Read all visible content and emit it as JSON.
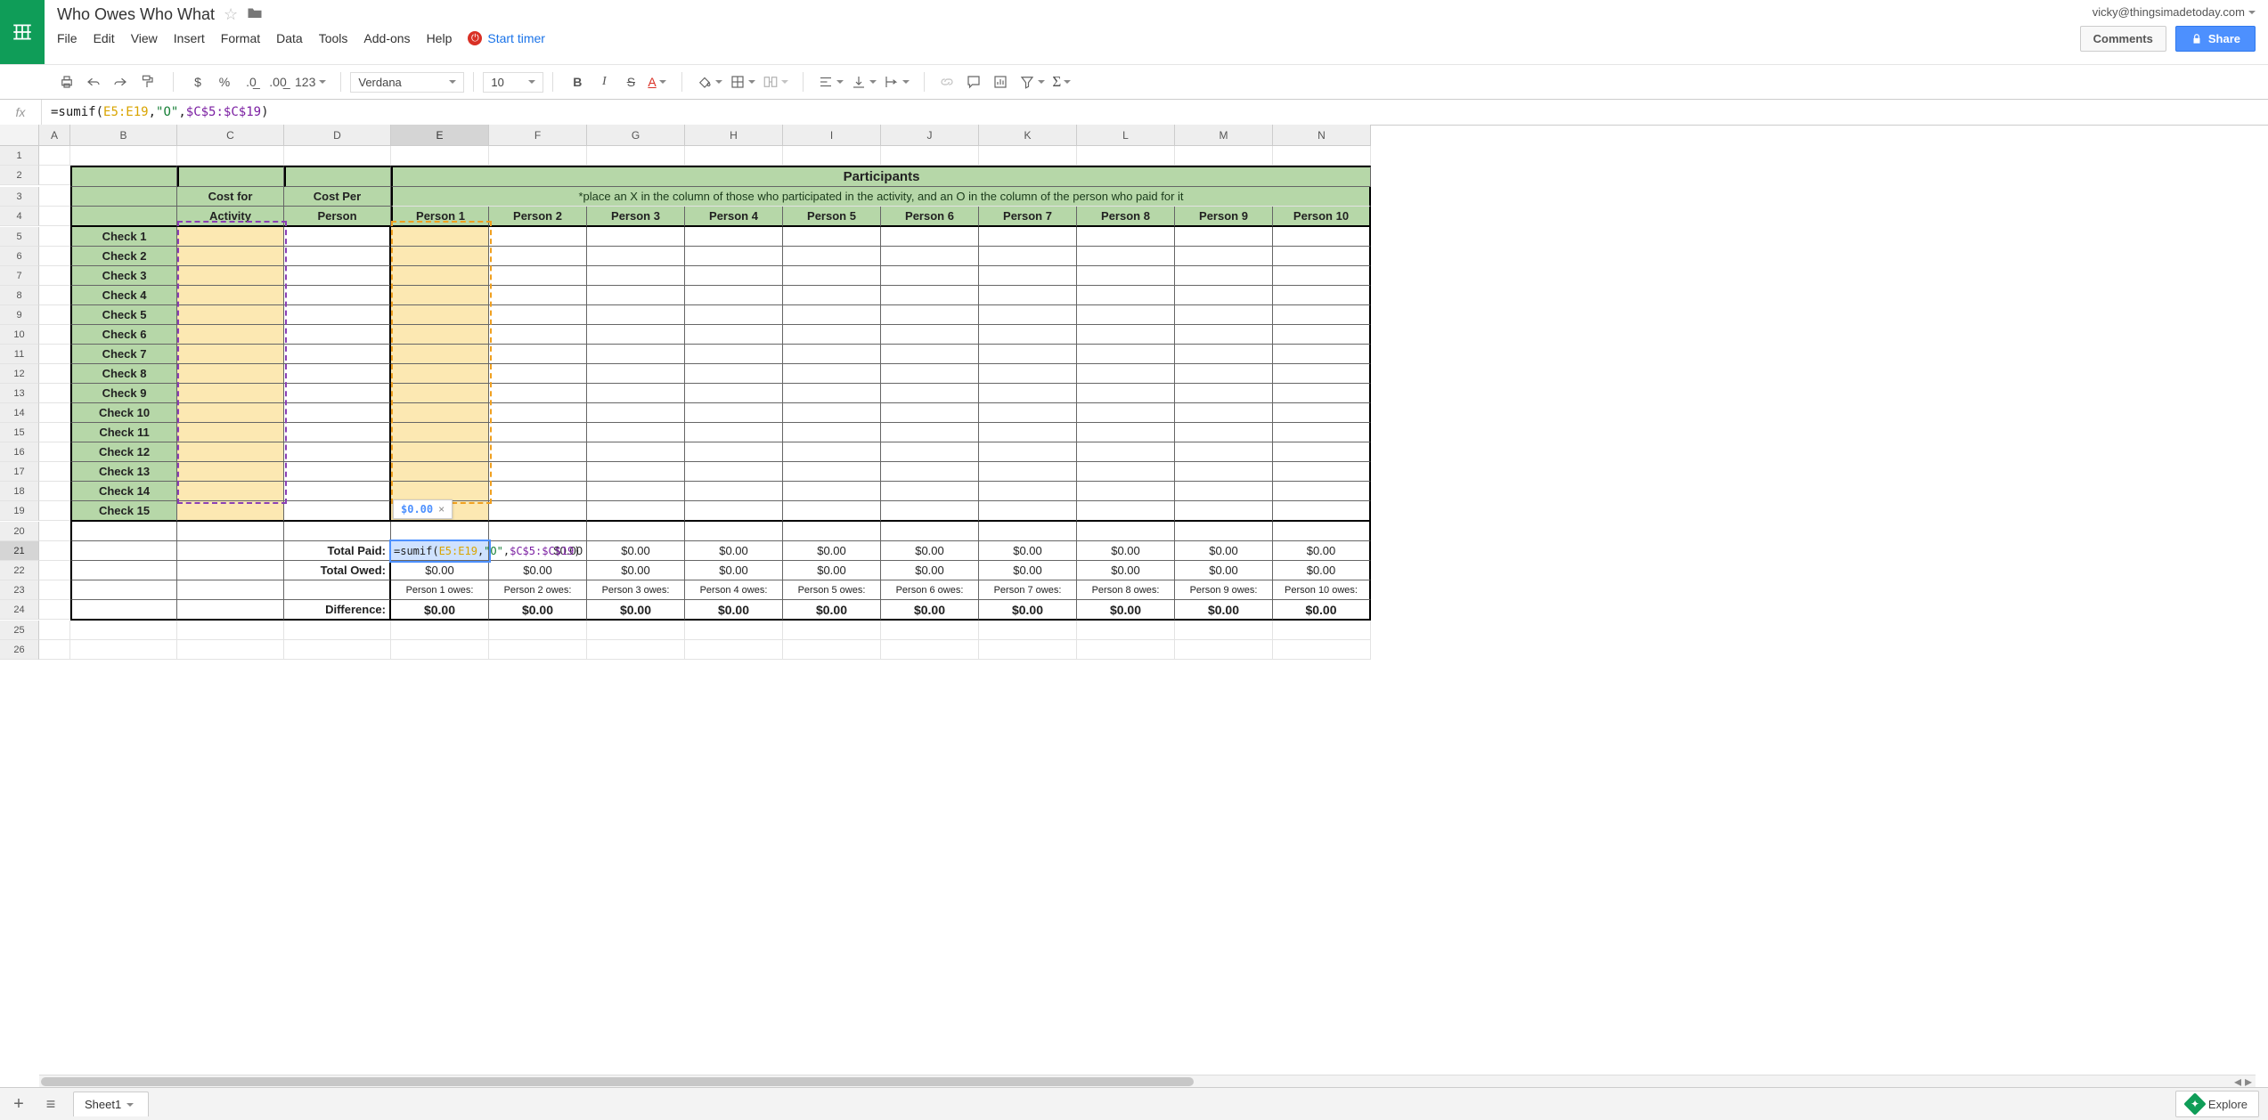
{
  "doc_title": "Who Owes Who What",
  "user_email": "vicky@thingsimadetoday.com",
  "buttons": {
    "comments": "Comments",
    "share": "Share"
  },
  "menu": [
    "File",
    "Edit",
    "View",
    "Insert",
    "Format",
    "Data",
    "Tools",
    "Add-ons",
    "Help"
  ],
  "timer_label": "Start timer",
  "toolbar": {
    "font": "Verdana",
    "size": "10",
    "more_formats": "123"
  },
  "formula_parts": {
    "prefix": "=sumif(",
    "range1": "E5:E19",
    "comma1": ",",
    "str": "\"O\"",
    "comma2": ",",
    "range2": "$C$5:$C$19",
    "suffix": ")"
  },
  "columns": [
    "A",
    "B",
    "C",
    "D",
    "E",
    "F",
    "G",
    "H",
    "I",
    "J",
    "K",
    "L",
    "M",
    "N"
  ],
  "rows": [
    "1",
    "2",
    "3",
    "4",
    "5",
    "6",
    "7",
    "8",
    "9",
    "10",
    "11",
    "12",
    "13",
    "14",
    "15",
    "16",
    "17",
    "18",
    "19",
    "20",
    "21",
    "22",
    "23",
    "24",
    "25",
    "26"
  ],
  "headers": {
    "participants": "Participants",
    "instruction": "*place an X in the column of those who participated in the activity, and an O in the column of the person who paid for it",
    "cost_for_activity_l1": "Cost for",
    "cost_for_activity_l2": "Activity",
    "cost_per_person_l1": "Cost Per",
    "cost_per_person_l2": "Person"
  },
  "persons": [
    "Person 1",
    "Person 2",
    "Person 3",
    "Person 4",
    "Person 5",
    "Person 6",
    "Person 7",
    "Person 8",
    "Person 9",
    "Person 10"
  ],
  "checks": [
    "Check 1",
    "Check 2",
    "Check 3",
    "Check 4",
    "Check 5",
    "Check 6",
    "Check 7",
    "Check 8",
    "Check 9",
    "Check 10",
    "Check 11",
    "Check 12",
    "Check 13",
    "Check 14",
    "Check 15"
  ],
  "totals": {
    "paid_label": "Total Paid:",
    "owed_label": "Total Owed:",
    "diff_label": "Difference:"
  },
  "owes_labels": [
    "Person 1 owes:",
    "Person 2 owes:",
    "Person 3 owes:",
    "Person 4 owes:",
    "Person 5 owes:",
    "Person 6 owes:",
    "Person 7 owes:",
    "Person 8 owes:",
    "Person 9 owes:",
    "Person 10 owes:"
  ],
  "zero_currency": "$0.00",
  "tooltip_value": "$0.00",
  "active_formula": {
    "prefix": "=sumif(",
    "range1": "E5:E19",
    "comma1": ",",
    "str": "\"O\"",
    "comma2": ",",
    "range2": "$C$5:$C$19",
    "suffix": ")",
    "tail_visible": "$0.00"
  },
  "sheet_tab": "Sheet1",
  "explore_label": "Explore"
}
